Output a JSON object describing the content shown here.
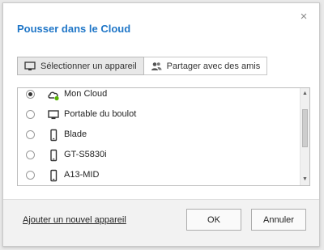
{
  "dialog": {
    "title": "Pousser dans le Cloud",
    "close_label": "×"
  },
  "tabs": [
    {
      "label": "Sélectionner un appareil",
      "icon": "monitor-icon",
      "active": true
    },
    {
      "label": "Partager avec des amis",
      "icon": "people-icon",
      "active": false
    }
  ],
  "devices": [
    {
      "label": "Mon Cloud",
      "icon": "cloud-icon",
      "selected": true
    },
    {
      "label": "Portable du boulot",
      "icon": "laptop-icon",
      "selected": false
    },
    {
      "label": "Blade",
      "icon": "phone-icon",
      "selected": false
    },
    {
      "label": "GT-S5830i",
      "icon": "phone-icon",
      "selected": false
    },
    {
      "label": "A13-MID",
      "icon": "phone-icon",
      "selected": false
    }
  ],
  "scrollbar": {
    "up_arrow": "▲",
    "down_arrow": "▼"
  },
  "footer": {
    "add_device_link": "Ajouter un nouvel appareil",
    "ok_label": "OK",
    "cancel_label": "Annuler"
  },
  "colors": {
    "accent": "#1f76c7",
    "cloud_badge": "#56b400"
  }
}
